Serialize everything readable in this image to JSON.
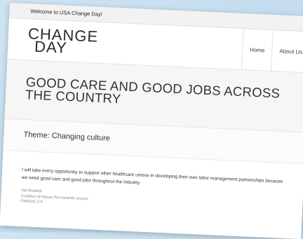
{
  "topbar": {
    "welcome": "Welcome to USA Change Day!"
  },
  "logo": {
    "line1": "CHANGE",
    "line2": "DAY"
  },
  "nav": {
    "items": [
      "Home",
      "About Us"
    ]
  },
  "page": {
    "title": "GOOD CARE AND GOOD JOBS ACROSS THE COUNTRY"
  },
  "theme": {
    "label": "Theme: Changing culture"
  },
  "quote": {
    "text": "I will take every opportunity to support other healthcare unions in developing their own labor management partnerships because we need good care and good jobs throughout the industry.",
    "author": "Hal Ruddick",
    "org": "Coalition of Kaiser Permanente Unions",
    "location": "Oakland, CA"
  },
  "colors": {
    "logo_red": "#c0392b",
    "logo_blue": "#2a4a8a",
    "background": "#cfe4f2"
  }
}
